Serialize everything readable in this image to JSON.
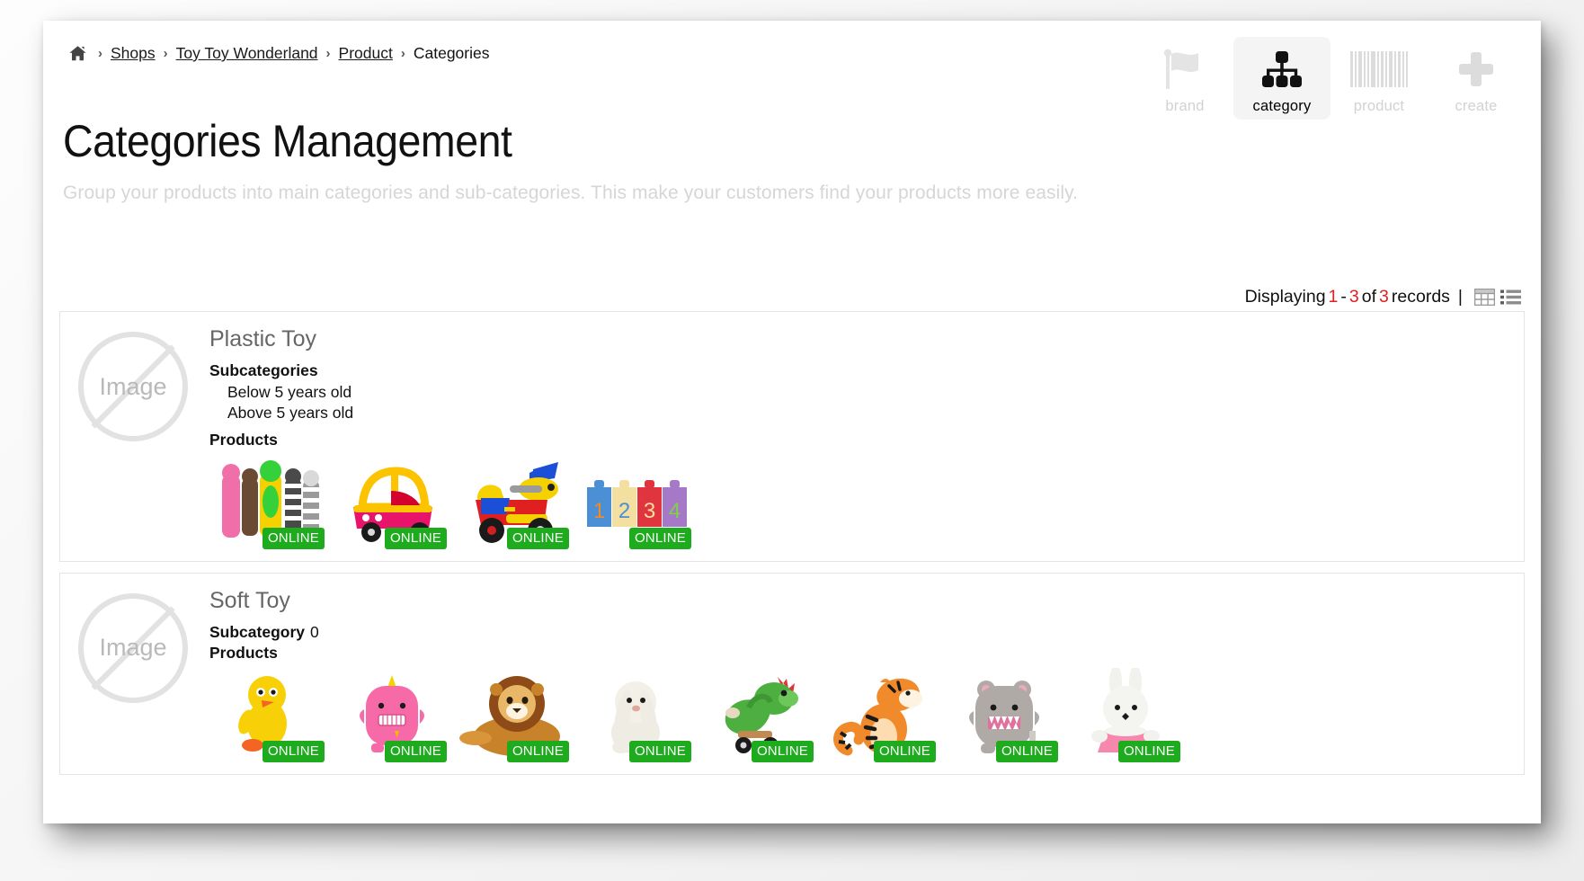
{
  "breadcrumb": {
    "home_icon": "home-icon",
    "separator": "›",
    "items": [
      {
        "label": "Shops",
        "link": true
      },
      {
        "label": "Toy Toy Wonderland",
        "link": true
      },
      {
        "label": "Product",
        "link": true
      },
      {
        "label": "Categories",
        "link": false
      }
    ]
  },
  "toolbar": {
    "items": [
      {
        "label": "brand",
        "icon": "flag-icon",
        "active": false
      },
      {
        "label": "category",
        "icon": "sitemap-icon",
        "active": true
      },
      {
        "label": "product",
        "icon": "barcode-icon",
        "active": false
      },
      {
        "label": "create",
        "icon": "plus-icon",
        "active": false
      }
    ]
  },
  "page": {
    "title": "Categories Management",
    "subtitle": "Group your products into main categories and sub-categories. This make your customers find your products more easily."
  },
  "displaying": {
    "prefix": "Displaying",
    "from": "1",
    "dash": "-",
    "to": "3",
    "of": "of",
    "total": "3",
    "suffix": "records",
    "pipe": "|",
    "grid_icon": "grid-view-icon",
    "list_icon": "list-view-icon",
    "accent_color": "#e02020"
  },
  "labels": {
    "subcategories": "Subcategories",
    "subcategory": "Subcategory",
    "products": "Products",
    "no_image": "Image",
    "status_online": "ONLINE"
  },
  "categories": [
    {
      "name": "Plastic Toy",
      "subcat_label": "Subcategories",
      "subcat_count": null,
      "subcategories": [
        "Below 5 years old",
        "Above 5 years old"
      ],
      "products": [
        {
          "name": "plastic-figures-set",
          "status": "ONLINE"
        },
        {
          "name": "ride-on-coupe-car",
          "status": "ONLINE"
        },
        {
          "name": "ride-on-motorbike",
          "status": "ONLINE"
        },
        {
          "name": "number-blocks-1234",
          "status": "ONLINE"
        }
      ]
    },
    {
      "name": "Soft Toy",
      "subcat_label": "Subcategory",
      "subcat_count": "0",
      "subcategories": [],
      "products": [
        {
          "name": "yellow-bird-plush",
          "status": "ONLINE"
        },
        {
          "name": "pink-monster-plush",
          "status": "ONLINE"
        },
        {
          "name": "lion-plush",
          "status": "ONLINE"
        },
        {
          "name": "white-bunny-plush",
          "status": "ONLINE"
        },
        {
          "name": "green-dragon-plush",
          "status": "ONLINE"
        },
        {
          "name": "tiger-plush",
          "status": "ONLINE"
        },
        {
          "name": "grey-monster-plush",
          "status": "ONLINE"
        },
        {
          "name": "white-rabbit-pink-dress-plush",
          "status": "ONLINE"
        }
      ]
    }
  ]
}
